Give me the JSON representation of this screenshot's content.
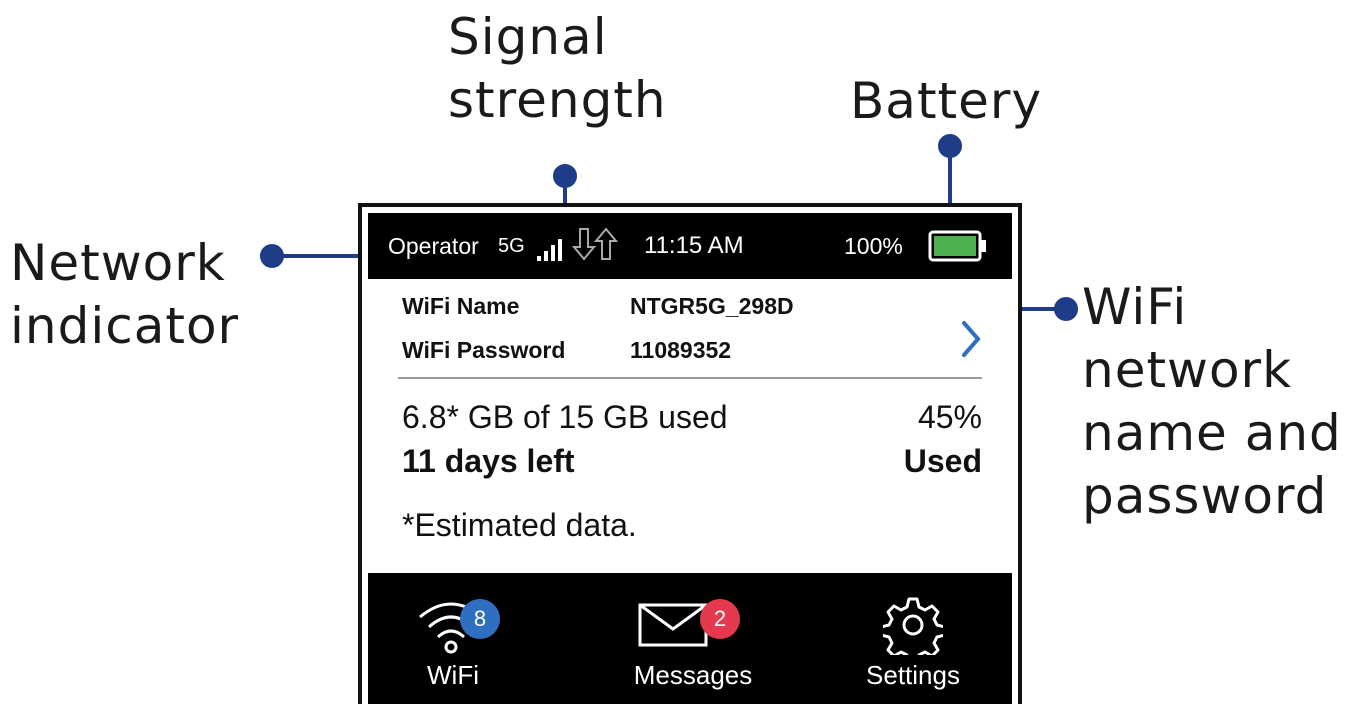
{
  "callouts": {
    "signal_strength_line1": "Signal",
    "signal_strength_line2": "strength",
    "battery": "Battery",
    "network_indicator_line1": "Network",
    "network_indicator_line2": "indicator",
    "wifi_line1": "WiFi",
    "wifi_line2": "network",
    "wifi_line3": "name and",
    "wifi_line4": "password"
  },
  "status_bar": {
    "operator": "Operator",
    "network_type": "5G",
    "time": "11:15 AM",
    "battery_percent": "100%",
    "battery_level": 1.0,
    "battery_color": "#4caf50"
  },
  "wifi": {
    "name_label": "WiFi Name",
    "name_value": "NTGR5G_298D",
    "password_label": "WiFi Password",
    "password_value": "11089352",
    "chevron_icon": "chevron-right-icon",
    "chevron_color": "#2f6fbf"
  },
  "usage": {
    "amount": "6.8* GB of 15 GB used",
    "days_left": "11 days left",
    "percent": "45%",
    "percent_label": "Used",
    "footnote": "*Estimated data."
  },
  "nav": {
    "wifi": {
      "label": "WiFi",
      "badge": "8",
      "icon": "wifi-icon",
      "badge_color": "#2f6fbf"
    },
    "messages": {
      "label": "Messages",
      "badge": "2",
      "icon": "envelope-icon",
      "badge_color": "#e5394d"
    },
    "settings": {
      "label": "Settings",
      "icon": "gear-icon"
    }
  },
  "colors": {
    "callout_line": "#1f3c88",
    "bar_background": "#000000"
  }
}
